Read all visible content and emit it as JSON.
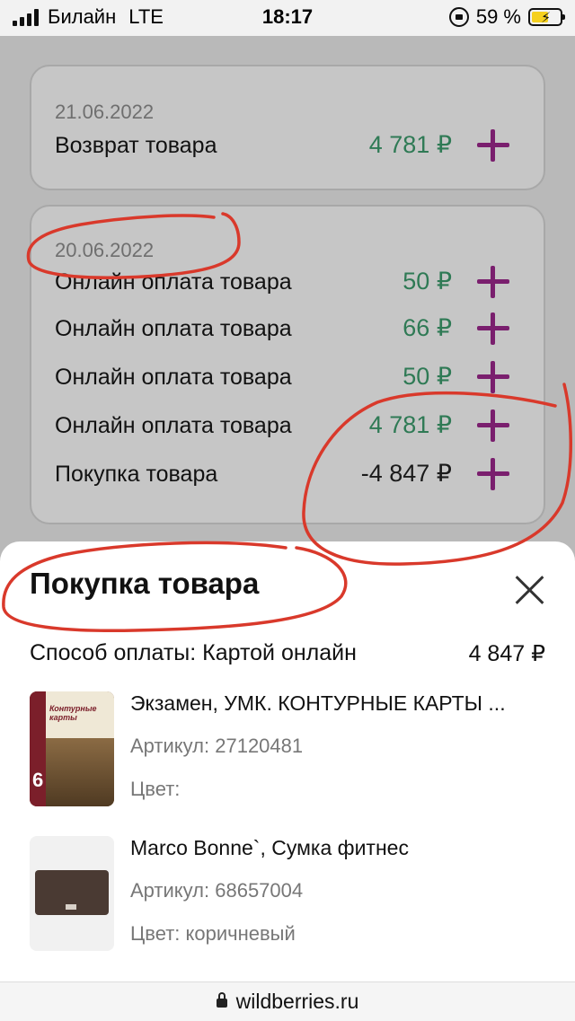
{
  "status_bar": {
    "carrier": "Билайн",
    "network": "LTE",
    "time": "18:17",
    "battery": "59 %",
    "battery_level_percent": 59
  },
  "cards": [
    {
      "date": "21.06.2022",
      "rows": [
        {
          "label": "Возврат товара",
          "amount": "4 781 ₽",
          "negative": false
        }
      ]
    },
    {
      "date": "20.06.2022",
      "rows": [
        {
          "label": "Онлайн оплата товара",
          "amount": "50 ₽",
          "negative": false
        },
        {
          "label": "Онлайн оплата товара",
          "amount": "66 ₽",
          "negative": false
        },
        {
          "label": "Онлайн оплата товара",
          "amount": "50 ₽",
          "negative": false
        },
        {
          "label": "Онлайн оплата товара",
          "amount": "4 781 ₽",
          "negative": false
        },
        {
          "label": "Покупка товара",
          "amount": "-4 847 ₽",
          "negative": true
        }
      ]
    }
  ],
  "sheet": {
    "title": "Покупка товара",
    "payment_method": "Способ оплаты: Картой онлайн",
    "total": "4 847 ₽",
    "items": [
      {
        "name": "Экзамен, УМК. КОНТУРНЫЕ КАРТЫ ...",
        "article": "Артикул: 27120481",
        "color": "Цвет:",
        "thumb": "book-cover",
        "book_number": "6",
        "book_title": "Контурные карты"
      },
      {
        "name": "Marco Bonne`, Сумка фитнес",
        "article": "Артикул: 68657004",
        "color": "Цвет: коричневый",
        "thumb": "brown-bag"
      }
    ]
  },
  "browser": {
    "url": "wildberries.ru"
  },
  "colors": {
    "positive_amount": "#2f7a55",
    "plus_icon": "#7a1f6e",
    "annotation": "#d9392b"
  }
}
